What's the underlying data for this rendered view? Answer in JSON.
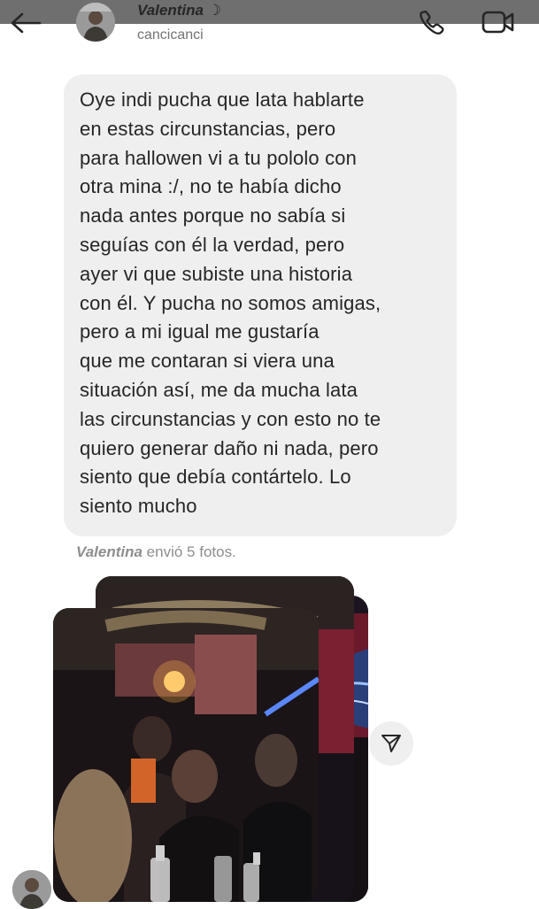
{
  "header": {
    "contact_name": "Valentina ☽",
    "username": "cancicanci",
    "icons": {
      "back": "arrow-left-icon",
      "call": "phone-icon",
      "video": "video-camera-icon"
    }
  },
  "message": {
    "lines": [
      "Oye indi pucha que lata hablarte",
      "en estas circunstancias, pero",
      "para hallowen vi a tu pololo con",
      "otra mina :/, no te había dicho",
      "nada antes porque no sabía si",
      "seguías con él la verdad, pero",
      "ayer vi que subiste una historia",
      "con él. Y pucha no somos amigas,",
      "pero a mi igual me gustaría",
      "que me contaran si viera una",
      "situación así, me da mucha lata",
      "las circunstancias y con esto no te",
      "quiero generar daño ni nada, pero",
      "siento que debía contártelo. Lo",
      "siento mucho"
    ]
  },
  "photos_notice": {
    "sender": "Valentina",
    "text": " envió 5 fotos."
  },
  "colors": {
    "bubble": "#efefef",
    "text": "#262626",
    "secondary_text": "#8e8e8e",
    "top_strip": "#6f6f6f"
  },
  "share_icon": "paper-plane-icon"
}
